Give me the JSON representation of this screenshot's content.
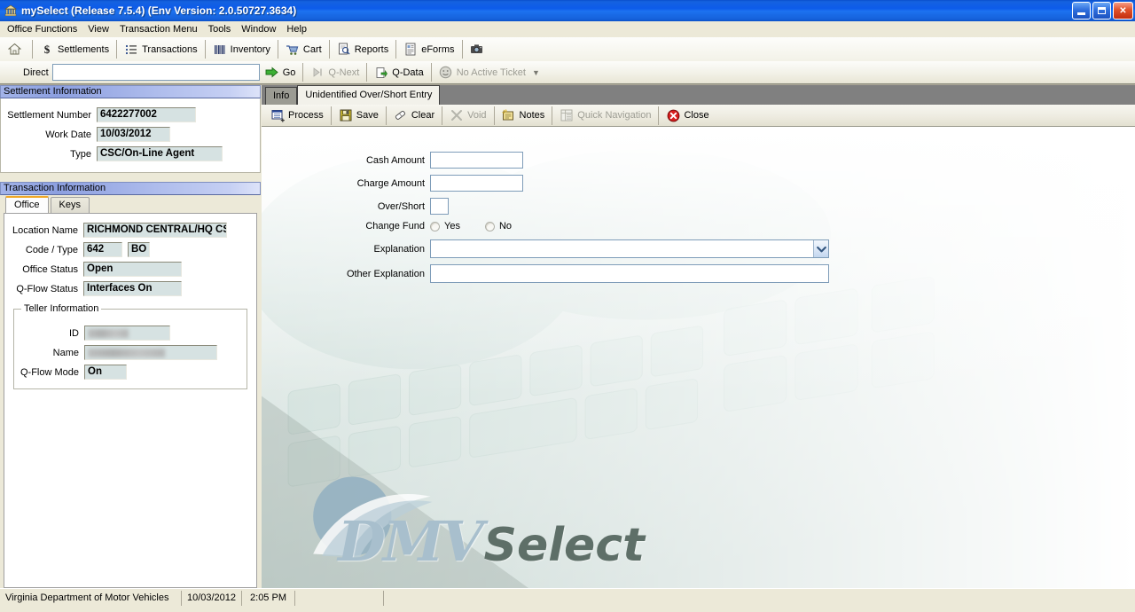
{
  "window": {
    "title": "mySelect (Release 7.5.4) (Env Version: 2.0.50727.3634)",
    "icon": "app-bank-icon",
    "minimize_label": "Minimize",
    "restore_label": "Restore",
    "close_label": "Close"
  },
  "menubar": {
    "items": [
      {
        "label": "Office Functions"
      },
      {
        "label": "View"
      },
      {
        "label": "Transaction Menu"
      },
      {
        "label": "Tools"
      },
      {
        "label": "Window"
      },
      {
        "label": "Help"
      }
    ]
  },
  "toolbar": {
    "items": [
      {
        "label": "",
        "icon": "home-icon",
        "name": "home"
      },
      {
        "label": "Settlements",
        "icon": "dollar-icon",
        "name": "settlements"
      },
      {
        "label": "Transactions",
        "icon": "list-icon",
        "name": "transactions"
      },
      {
        "label": "Inventory",
        "icon": "barcode-icon",
        "name": "inventory"
      },
      {
        "label": "Cart",
        "icon": "cart-icon",
        "name": "cart"
      },
      {
        "label": "Reports",
        "icon": "report-icon",
        "name": "reports"
      },
      {
        "label": "eForms",
        "icon": "eforms-icon",
        "name": "eforms"
      },
      {
        "label": "",
        "icon": "camera-icon",
        "name": "camera"
      }
    ]
  },
  "direct_bar": {
    "label": "Direct",
    "input_value": "",
    "input_placeholder": "",
    "go_label": "Go",
    "qnext_label": "Q-Next",
    "qdata_label": "Q-Data",
    "ticket_label": "No Active Ticket"
  },
  "settlement_information": {
    "header": "Settlement Information",
    "fields": [
      {
        "label": "Settlement Number",
        "value": "6422277002",
        "width": 110
      },
      {
        "label": "Work Date",
        "value": "10/03/2012",
        "width": 80
      },
      {
        "label": "Type",
        "value": "CSC/On-Line Agent",
        "width": 140
      }
    ]
  },
  "transaction_information": {
    "header": "Transaction Information",
    "tabs": [
      {
        "label": "Office",
        "active": true
      },
      {
        "label": "Keys",
        "active": false
      }
    ],
    "office": {
      "location_name_label": "Location Name",
      "location_name_value": "RICHMOND CENTRAL/HQ CSC",
      "code_type_label": "Code / Type",
      "code_value": "642",
      "type_value": "BO",
      "office_status_label": "Office Status",
      "office_status_value": "Open",
      "qflow_status_label": "Q-Flow Status",
      "qflow_status_value": "Interfaces On",
      "teller": {
        "title": "Teller Information",
        "id_label": "ID",
        "id_value": "",
        "name_label": "Name",
        "name_value": "",
        "qflow_mode_label": "Q-Flow Mode",
        "qflow_mode_value": "On"
      }
    }
  },
  "main_panel": {
    "tabs": [
      {
        "label": "Info",
        "active": false
      },
      {
        "label": "Unidentified Over/Short Entry",
        "active": true
      }
    ],
    "toolbar": [
      {
        "label": "Process",
        "icon": "process-icon",
        "enabled": true
      },
      {
        "label": "Save",
        "icon": "save-icon",
        "enabled": true
      },
      {
        "label": "Clear",
        "icon": "eraser-icon",
        "enabled": true
      },
      {
        "label": "Void",
        "icon": "void-x-icon",
        "enabled": false
      },
      {
        "label": "Notes",
        "icon": "notes-icon",
        "enabled": true
      },
      {
        "label": "Quick Navigation",
        "icon": "quick-nav-icon",
        "enabled": false
      },
      {
        "label": "Close",
        "icon": "close-circle-icon",
        "enabled": true
      }
    ],
    "form": {
      "cash_amount_label": "Cash Amount",
      "cash_amount_value": "",
      "charge_amount_label": "Charge Amount",
      "charge_amount_value": "",
      "over_short_label": "Over/Short",
      "over_short_value": "",
      "change_fund_label": "Change Fund",
      "change_fund_yes": "Yes",
      "change_fund_no": "No",
      "explanation_label": "Explanation",
      "explanation_value": "",
      "other_explanation_label": "Other Explanation",
      "other_explanation_value": ""
    },
    "watermark": {
      "dmv": "DMV",
      "select": "Select"
    }
  },
  "statusbar": {
    "cells": [
      "Virginia Department of Motor Vehicles",
      "10/03/2012",
      "2:05 PM",
      "",
      ""
    ]
  },
  "colors": {
    "title_blue": "#0d5bea",
    "panel_header_blue": "#8c9fe0",
    "field_bg": "#d6e2e2",
    "active_tab_accent": "#f0a726",
    "tabstrip_gray": "#808080",
    "chrome": "#ece9d8"
  }
}
